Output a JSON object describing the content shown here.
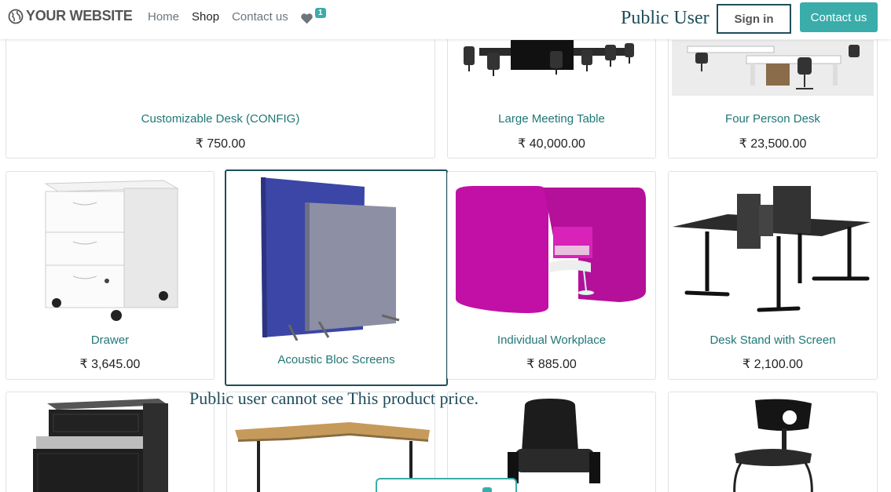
{
  "header": {
    "logo_text": "YOUR WEBSITE",
    "nav": [
      {
        "label": "Home"
      },
      {
        "label": "Shop"
      },
      {
        "label": "Contact us"
      }
    ],
    "wishlist_count": "1",
    "public_user_label": "Public User",
    "signin_label": "Sign in",
    "contact_label": "Contact us"
  },
  "products": [
    {
      "name": "Customizable Desk (CONFIG)",
      "price": "₹ 750.00"
    },
    {
      "name": "Large Meeting Table",
      "price": "₹ 40,000.00"
    },
    {
      "name": "Four Person Desk",
      "price": "₹ 23,500.00"
    },
    {
      "name": "Drawer",
      "price": "₹ 3,645.00"
    },
    {
      "name": "Acoustic Bloc Screens",
      "price": ""
    },
    {
      "name": "Individual Workplace",
      "price": "₹ 885.00"
    },
    {
      "name": "Desk Stand with Screen",
      "price": "₹ 2,100.00"
    }
  ],
  "note": "Public user cannot see This product price.",
  "colors": {
    "accent": "#3aadaa",
    "dark": "#1f4e5a",
    "product_name": "#1f7775"
  }
}
